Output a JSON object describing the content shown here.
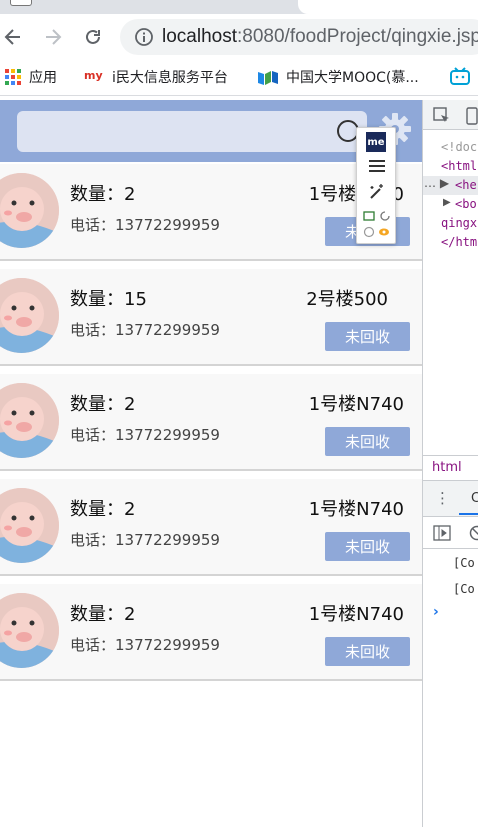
{
  "browser": {
    "url_host": "localhost",
    "url_path": ":8080/foodProject/qingxie.jsp",
    "bookmarks": [
      {
        "label": "应用",
        "icon": "apps-grid-icon"
      },
      {
        "label": "i民大信息服务平台",
        "icon": "my-logo-icon"
      },
      {
        "label": "中国大学MOOC(慕...",
        "icon": "mooc-logo-icon"
      },
      {
        "label": "",
        "icon": "bilibili-icon"
      }
    ]
  },
  "search": {
    "placeholder": ""
  },
  "orders": [
    {
      "qty_label": "数量：2",
      "phone_label": "电话：13772299959",
      "addr": "1号楼N740",
      "status": "未回收"
    },
    {
      "qty_label": "数量：15",
      "phone_label": "电话：13772299959",
      "addr": "2号楼500",
      "status": "未回收"
    },
    {
      "qty_label": "数量：2",
      "phone_label": "电话：13772299959",
      "addr": "1号楼N740",
      "status": "未回收"
    },
    {
      "qty_label": "数量：2",
      "phone_label": "电话：13772299959",
      "addr": "1号楼N740",
      "status": "未回收"
    },
    {
      "qty_label": "数量：2",
      "phone_label": "电话：13772299959",
      "addr": "1号楼N740",
      "status": "未回收"
    }
  ],
  "extension": {
    "logo": "me"
  },
  "devtools": {
    "lines": [
      "<!doc",
      "<html",
      "<he",
      "<bo",
      "qingx",
      "</htm"
    ],
    "crumb": "html",
    "console_tab": "Co",
    "console_lines": [
      "[Co",
      "[Co"
    ]
  },
  "colors": {
    "accent": "#8fa8d8",
    "search_bg": "#dde3f2"
  }
}
